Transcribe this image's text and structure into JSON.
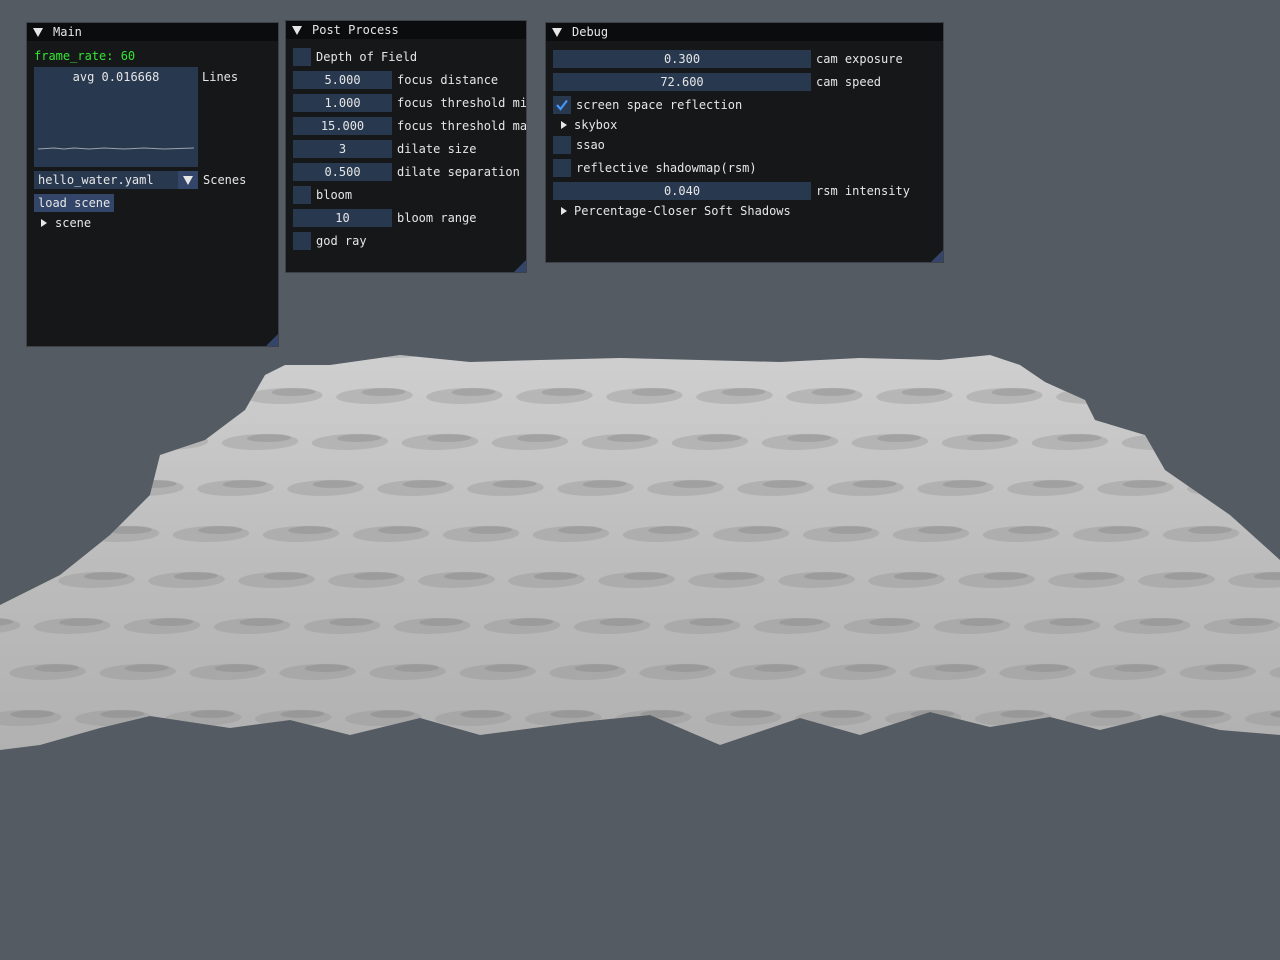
{
  "main": {
    "title": "Main",
    "frame_rate_text": "frame_rate: 60",
    "plot_overlay": "avg 0.016668",
    "plot_label": "Lines",
    "scene_select_value": "hello_water.yaml",
    "scenes_label": "Scenes",
    "load_button": "load scene",
    "tree_scene": "scene"
  },
  "post": {
    "title": "Post Process",
    "depth_of_field": "Depth of Field",
    "focus_distance_value": "5.000",
    "focus_distance_label": "focus distance",
    "threshold_min_value": "1.000",
    "threshold_min_label": "focus threshold min",
    "threshold_max_value": "15.000",
    "threshold_max_label": "focus threshold max",
    "dilate_size_value": "3",
    "dilate_size_label": "dilate size",
    "dilate_sep_value": "0.500",
    "dilate_sep_label": "dilate separation",
    "bloom": "bloom",
    "bloom_range_value": "10",
    "bloom_range_label": "bloom range",
    "god_ray": "god ray"
  },
  "debug": {
    "title": "Debug",
    "cam_exposure_value": "0.300",
    "cam_exposure_label": "cam exposure",
    "cam_speed_value": "72.600",
    "cam_speed_label": "cam speed",
    "ssr_label": "screen space reflection",
    "ssr_checked": true,
    "skybox": "skybox",
    "ssao": "ssao",
    "rsm_label": "reflective shadowmap(rsm)",
    "rsm_intensity_value": "0.040",
    "rsm_intensity_label": "rsm intensity",
    "pcss": "Percentage-Closer Soft Shadows"
  },
  "colors": {
    "background": "#545b63",
    "window_bg": "#161719",
    "frame_bg": "#28384f",
    "frame_rate_text": "#33e633",
    "checkmark": "#4296fa"
  },
  "icons": [
    "collapse-triangle-icon",
    "tree-arrow-icon",
    "combo-arrow-icon",
    "checkmark-icon",
    "resize-grip-icon"
  ]
}
